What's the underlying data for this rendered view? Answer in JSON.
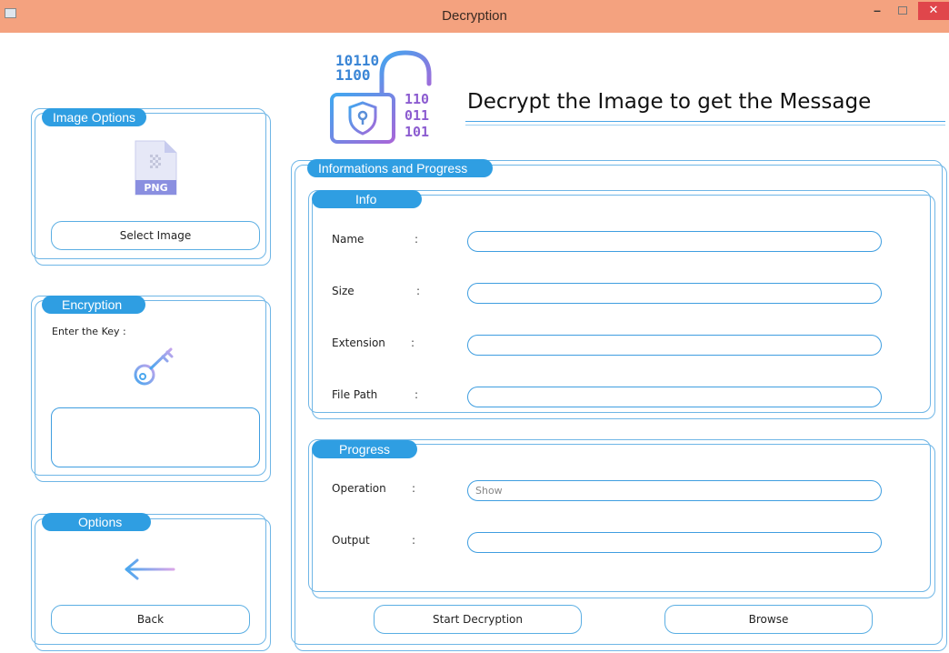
{
  "window": {
    "title": "Decryption",
    "minimize": "–",
    "close": "✕"
  },
  "header": {
    "heading": "Decrypt the Image to get the Message",
    "logo_icon": "binary-padlock-shield-icon"
  },
  "image_options": {
    "title": "Image Options",
    "file_badge": "PNG",
    "select_button": "Select Image"
  },
  "encryption": {
    "title": "Encryption",
    "key_label": "Enter the Key :",
    "key_value": ""
  },
  "options": {
    "title": "Options",
    "back_button": "Back"
  },
  "info_progress": {
    "title": "Informations and Progress",
    "info": {
      "title": "Info",
      "fields": [
        {
          "label": "Name",
          "colon": ":",
          "value": ""
        },
        {
          "label": "Size",
          "colon": ":",
          "value": ""
        },
        {
          "label": "Extension",
          "colon": ":",
          "value": ""
        },
        {
          "label": "File Path",
          "colon": ":",
          "value": ""
        }
      ]
    },
    "progress": {
      "title": "Progress",
      "fields": [
        {
          "label": "Operation",
          "colon": ":",
          "value": "Show"
        },
        {
          "label": "Output",
          "colon": ":",
          "value": ""
        }
      ]
    },
    "start_button": "Start Decryption",
    "browse_button": "Browse"
  },
  "colors": {
    "accent": "#2f9ee2",
    "border": "#6fb6e6",
    "titlebar": "#f4a27f",
    "close": "#e0464b"
  }
}
